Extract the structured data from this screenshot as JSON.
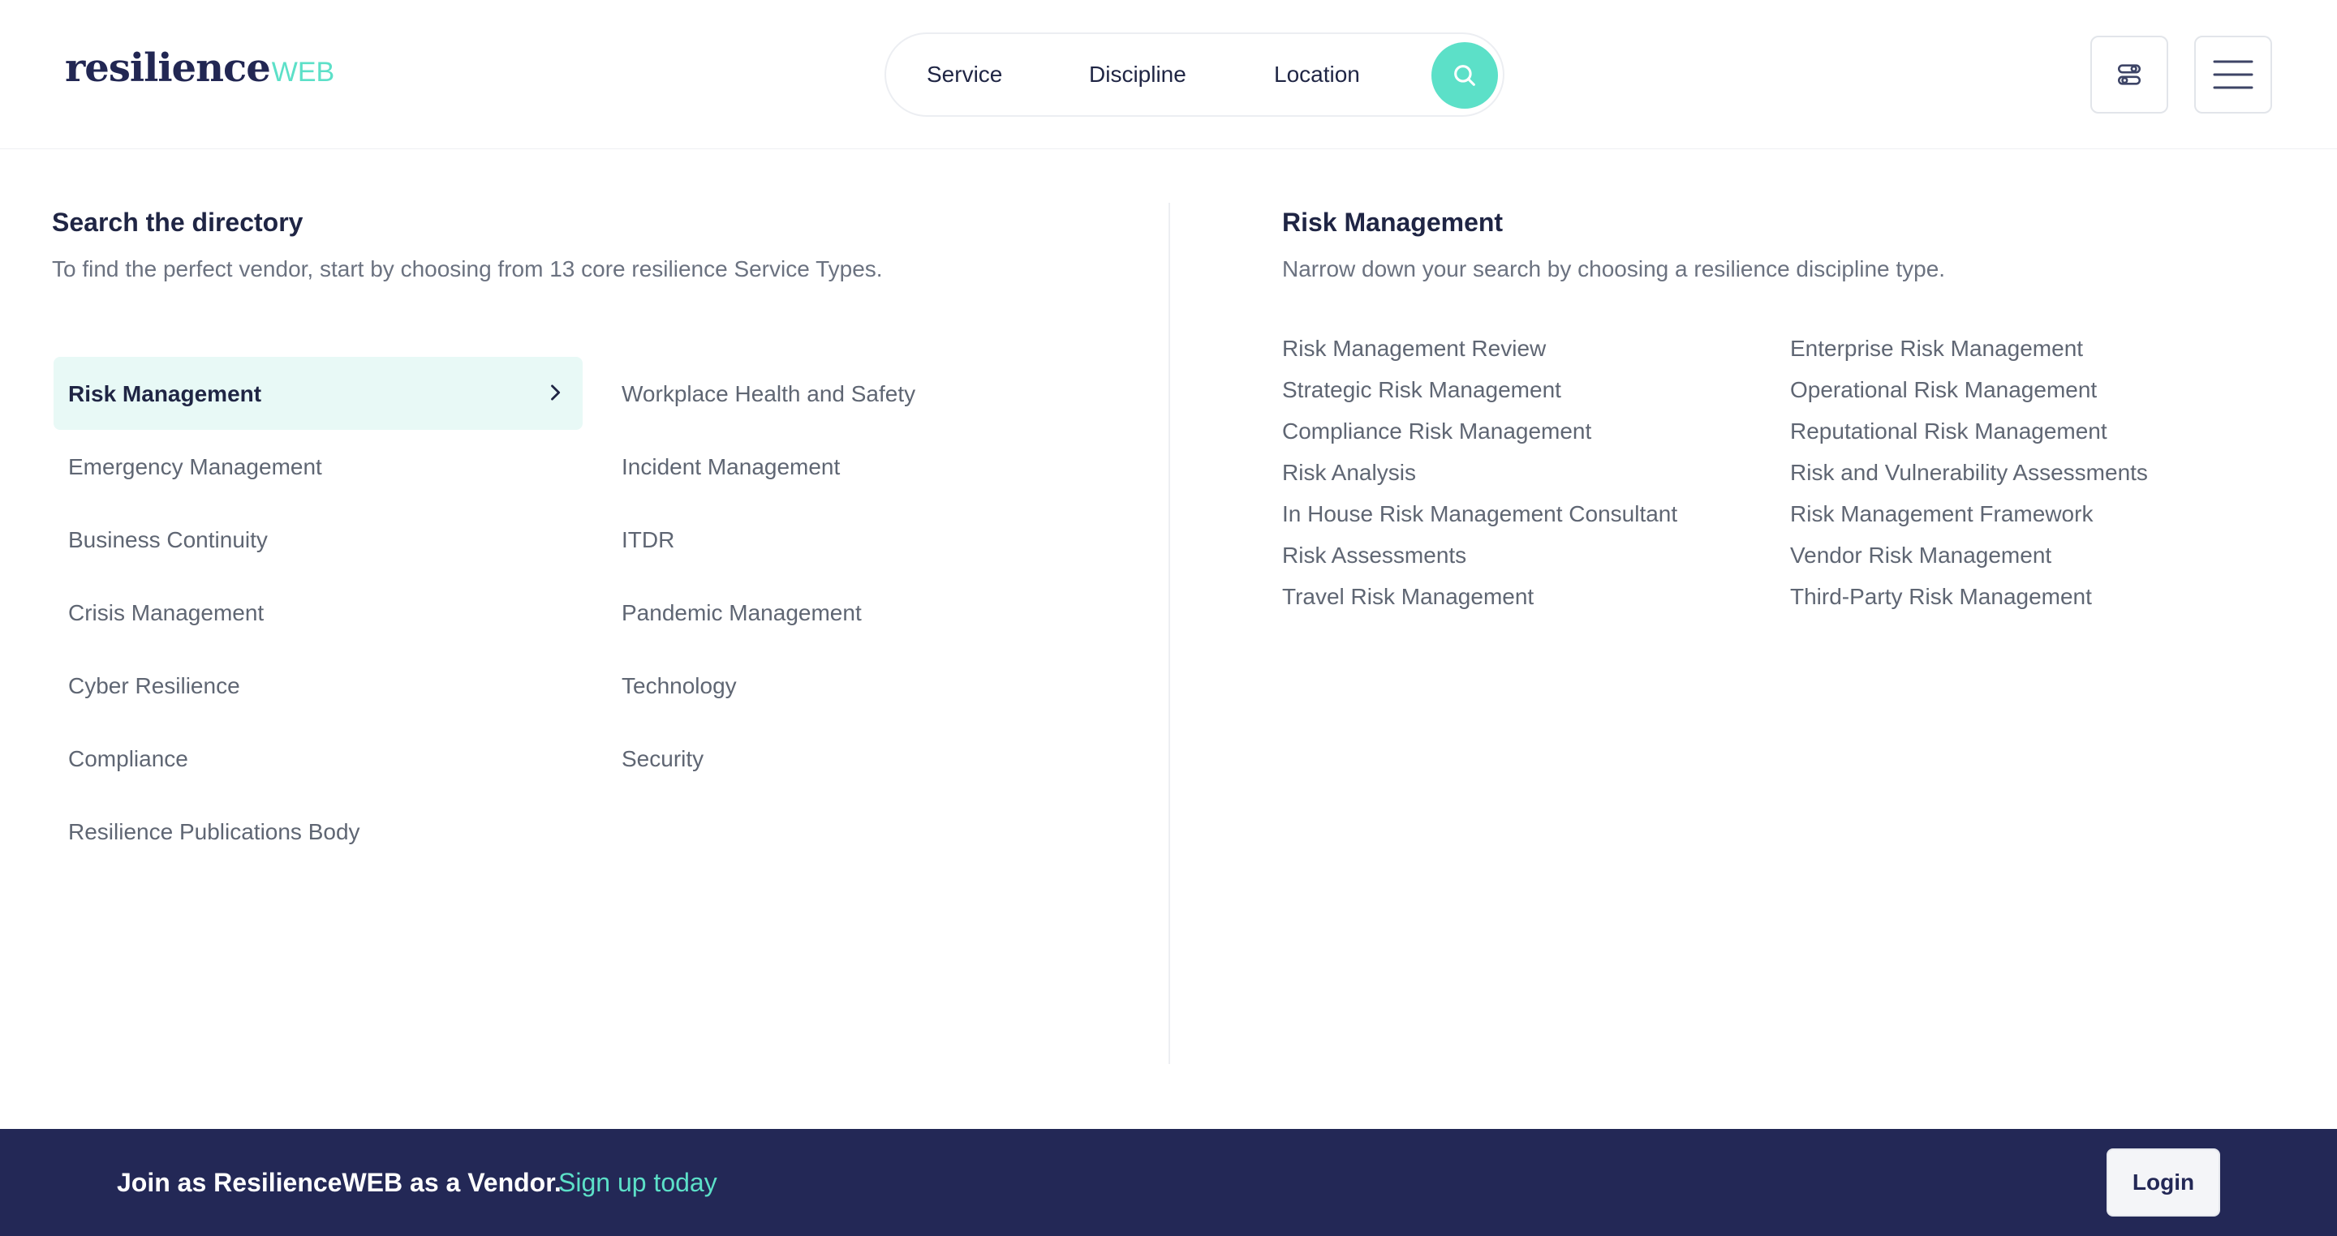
{
  "header": {
    "logo_main": "resilience",
    "logo_suffix": "WEB",
    "search": {
      "service_label": "Service",
      "discipline_label": "Discipline",
      "location_label": "Location"
    }
  },
  "directory": {
    "title": "Search the directory",
    "subtitle": "To find the perfect vendor, start by choosing from 13 core resilience Service Types.",
    "active_service": "Risk Management",
    "services_col1": [
      "Emergency Management",
      "Business Continuity",
      "Crisis Management",
      "Cyber Resilience",
      "Compliance",
      "Resilience Publications Body"
    ],
    "services_col2": [
      "Workplace Health and Safety",
      "Incident Management",
      "ITDR",
      "Pandemic Management",
      "Technology",
      "Security"
    ]
  },
  "disciplines": {
    "title": "Risk Management",
    "subtitle": "Narrow down your search by choosing a resilience discipline type.",
    "col1": [
      "Risk Management Review",
      "Strategic Risk Management",
      "Compliance Risk Management",
      "Risk Analysis",
      "In House Risk Management Consultant",
      "Risk Assessments",
      "Travel Risk Management"
    ],
    "col2": [
      "Enterprise Risk Management",
      "Operational Risk Management",
      "Reputational Risk Management",
      "Risk and Vulnerability Assessments",
      "Risk Management Framework",
      "Vendor Risk Management",
      "Third-Party Risk Management"
    ]
  },
  "footer": {
    "join_text": "Join as ResilienceWEB as a Vendor.",
    "signup_link": "Sign up today",
    "login_label": "Login"
  },
  "colors": {
    "brand_navy": "#232856",
    "accent_teal": "#5ce0c8",
    "active_bg": "#e8f9f6"
  }
}
